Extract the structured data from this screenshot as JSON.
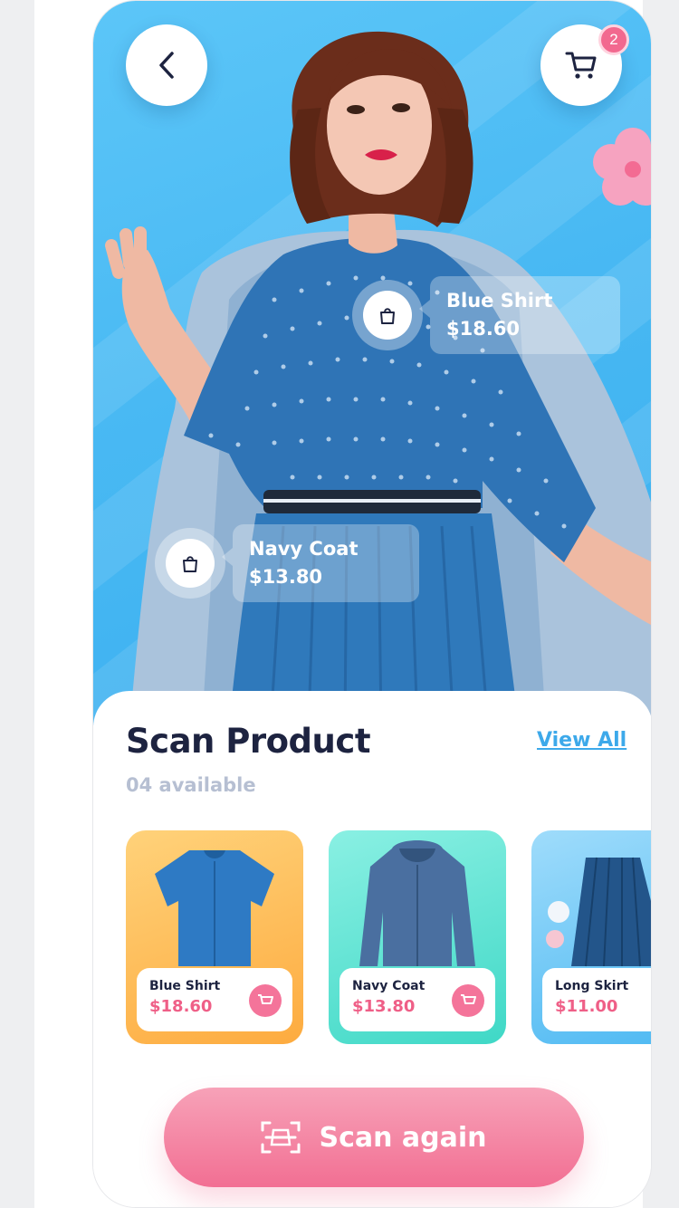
{
  "header": {
    "back_icon": "chevron-left-icon",
    "cart_icon": "cart-icon",
    "cart_count": "2"
  },
  "hero": {
    "tags": [
      {
        "name": "Blue Shirt",
        "price": "$18.60",
        "icon": "bag-icon"
      },
      {
        "name": "Navy Coat",
        "price": "$13.80",
        "icon": "bag-icon"
      }
    ]
  },
  "section": {
    "title": "Scan Product",
    "view_all": "View All",
    "subtitle": "04 available"
  },
  "products": [
    {
      "name": "Blue Shirt",
      "price": "$18.60",
      "bg": "#fdb14a"
    },
    {
      "name": "Navy Coat",
      "price": "$13.80",
      "bg": "#4fe0d0"
    },
    {
      "name": "Long Skirt",
      "price": "$11.00",
      "bg": "#5cc2f5"
    }
  ],
  "actions": {
    "scan_again": "Scan again",
    "scan_icon": "scan-icon"
  },
  "colors": {
    "accent_pink": "#f26f93",
    "accent_blue": "#3da9ea",
    "hero_blue": "#49b9f3",
    "title_dark": "#1d2340"
  }
}
